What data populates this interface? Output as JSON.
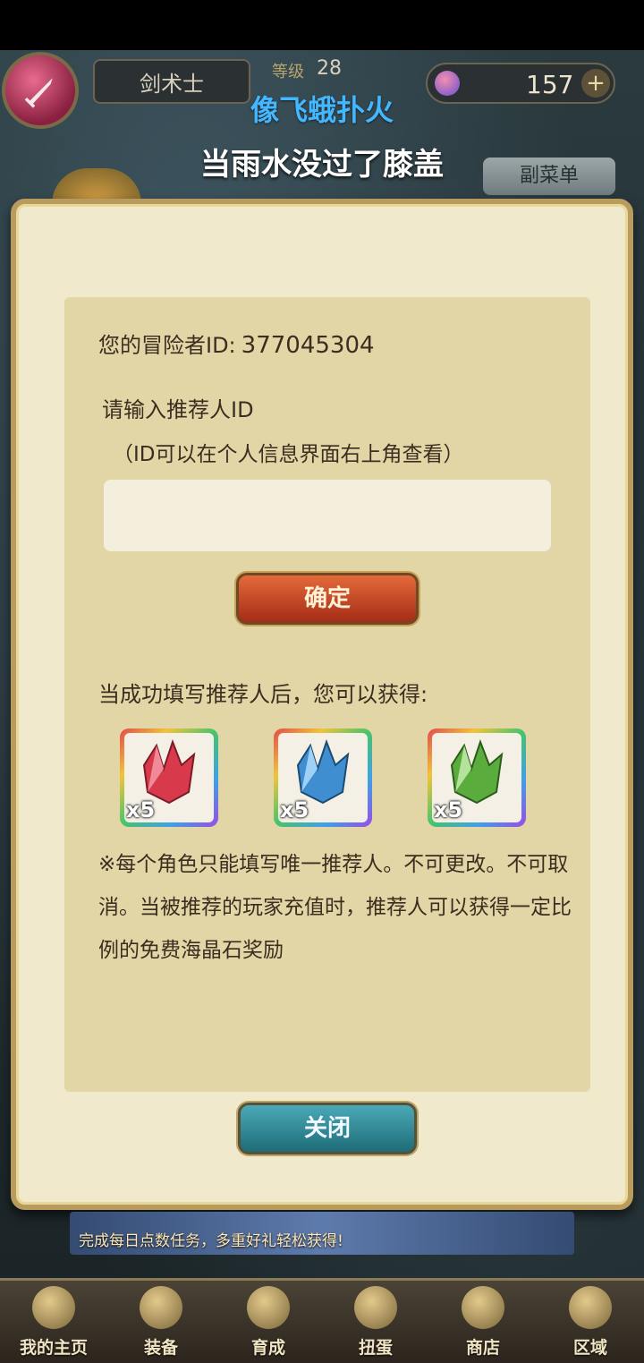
{
  "hud": {
    "job": "剑术士",
    "level_label": "等级",
    "level": "28",
    "gems": "157",
    "plus": "+"
  },
  "overlay": {
    "lyric_line1": "像飞蛾扑火",
    "lyric_line2": "当雨水没过了膝盖"
  },
  "submenu_label": "副菜单",
  "dialog": {
    "id_label": "您的冒险者ID:",
    "id_value": "377045304",
    "prompt": "请输入推荐人ID",
    "hint": "（ID可以在个人信息界面右上角查看）",
    "input_value": "",
    "input_placeholder": "",
    "confirm_label": "确定",
    "reward_title": "当成功填写推荐人后，您可以获得:",
    "rewards": [
      {
        "name": "red-crystal-icon",
        "count": "x5",
        "color": "#d8394b"
      },
      {
        "name": "blue-crystal-icon",
        "count": "x5",
        "color": "#3f8fd0"
      },
      {
        "name": "green-crystal-icon",
        "count": "x5",
        "color": "#5aac3c"
      }
    ],
    "notice": "※每个角色只能填写唯一推荐人。不可更改。不可取消。当被推荐的玩家充值时，推荐人可以获得一定比例的免费海晶石奖励",
    "close_label": "关闭"
  },
  "banner": {
    "text": "完成每日点数任务，多重好礼轻松获得!"
  },
  "nav": [
    {
      "label": "我的主页",
      "icon": "scroll-icon"
    },
    {
      "label": "装备",
      "icon": "helmet-icon"
    },
    {
      "label": "育成",
      "icon": "sword-icon"
    },
    {
      "label": "扭蛋",
      "icon": "capsule-icon"
    },
    {
      "label": "商店",
      "icon": "bag-icon"
    },
    {
      "label": "区域",
      "icon": "globe-icon"
    }
  ]
}
